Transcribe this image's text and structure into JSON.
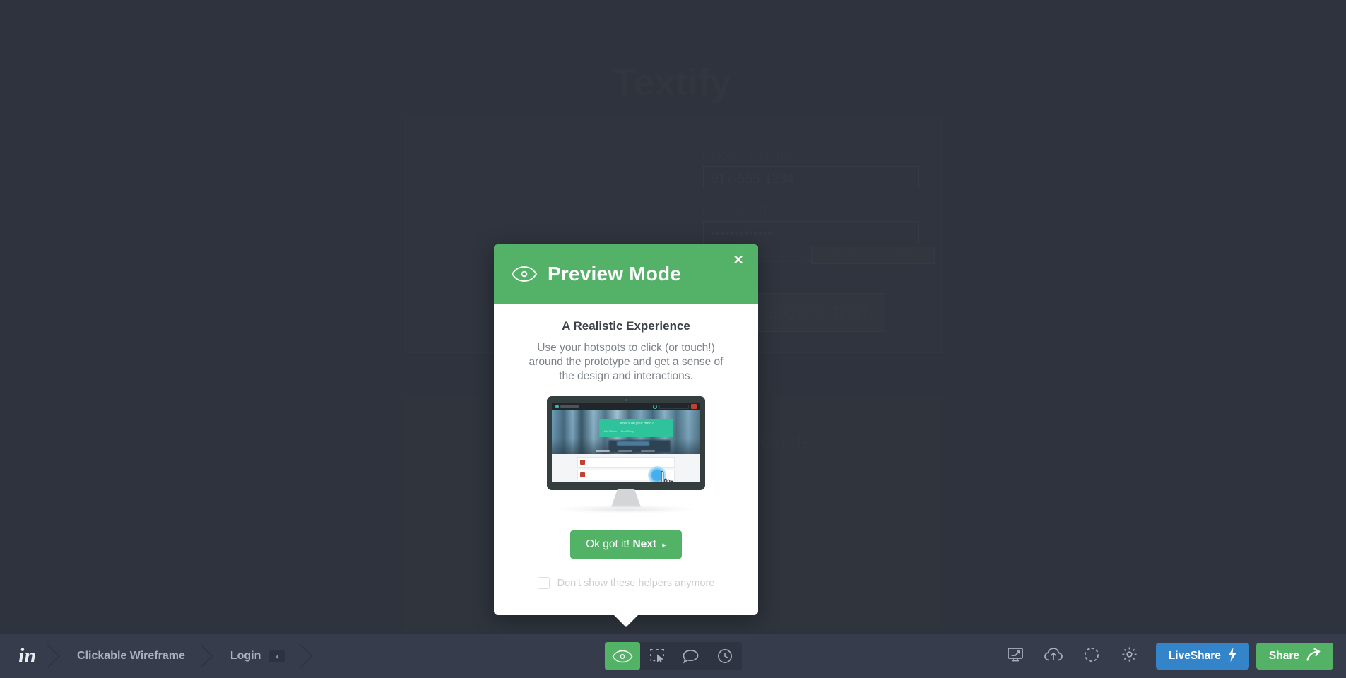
{
  "background_prototype": {
    "title": "Textify",
    "form": {
      "phone_label": "Phone Number:",
      "phone_value": "917-555-1234",
      "password_label": "Password:",
      "password_value": "•••••••••••••",
      "remember_me": "remember me",
      "forgot_password": "I forgot my password",
      "submit_label": "Login To Textify"
    },
    "tagline_fragment": "seconds."
  },
  "modal": {
    "header": {
      "title": "Preview Mode",
      "eye_icon": "eye-icon",
      "close_icon": "close-icon",
      "background_color": "#54b268"
    },
    "body": {
      "heading": "A Realistic Experience",
      "text": "Use your hotspots to click (or touch!) around the prototype and get a sense of the design and interactions."
    },
    "illustration": {
      "name": "monitor-preview-illustration",
      "screen": {
        "hero_card_title": "What's on your mind?",
        "hero_card_button_1": "Add Photo",
        "hero_card_button_2": "Post Story",
        "hotspot_icon": "hotspot-pulse-icon",
        "cursor_icon": "hand-cursor-icon"
      }
    },
    "primary_button": {
      "prefix": "Ok got it!",
      "emphasis": "Next",
      "caret": "▸",
      "color": "#52b265"
    },
    "checkbox": {
      "label": "Don't show these helpers anymore",
      "checked": false
    }
  },
  "toolbar": {
    "logo": "in",
    "breadcrumbs": [
      {
        "label": "Clickable Wireframe",
        "badge": null
      },
      {
        "label": "Login",
        "badge": "▴"
      }
    ],
    "center_tools": [
      {
        "name": "preview-mode-tool",
        "icon": "eye-icon",
        "active": true
      },
      {
        "name": "hotspot-tool",
        "icon": "hotspot-select-icon",
        "active": false
      },
      {
        "name": "comment-tool",
        "icon": "speech-bubble-icon",
        "active": false
      },
      {
        "name": "history-tool",
        "icon": "clock-icon",
        "active": false
      }
    ],
    "right_tools": [
      {
        "name": "fullscreen-tool",
        "icon": "monitor-expand-icon"
      },
      {
        "name": "upload-tool",
        "icon": "cloud-upload-icon"
      },
      {
        "name": "refresh-tool",
        "icon": "dashed-circle-icon"
      },
      {
        "name": "settings-tool",
        "icon": "gear-icon"
      }
    ],
    "liveshare": {
      "label": "LiveShare",
      "icon": "lightning-bolt-icon",
      "color": "#3484c9"
    },
    "share": {
      "label": "Share",
      "icon": "arrow-share-icon",
      "color": "#53b266"
    }
  }
}
